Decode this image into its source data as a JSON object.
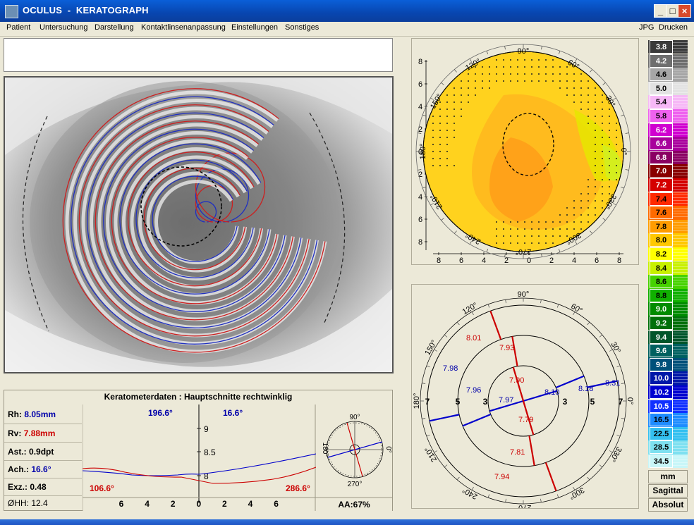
{
  "window": {
    "title": "OCULUS  -  KERATOGRAPH",
    "minimize_label": "_",
    "maximize_label": "□",
    "close_label": "×"
  },
  "menu": {
    "items": [
      "Patient",
      "Untersuchung",
      "Darstellung",
      "Kontaktlinsenanpassung",
      "Einstellungen",
      "Sonstiges"
    ],
    "right_items": [
      "JPG",
      "Drucken"
    ]
  },
  "topo_map": {
    "y_ticks": [
      "8",
      "6",
      "4",
      "2",
      "0",
      "2",
      "4",
      "6",
      "8"
    ],
    "x_ticks": [
      "8",
      "6",
      "4",
      "2",
      "0",
      "2",
      "4",
      "6",
      "8"
    ],
    "angle_labels": [
      "90°",
      "60°",
      "30°",
      "0°",
      "330°",
      "300°",
      "270°",
      "240°",
      "210°",
      "180°",
      "150°",
      "120°"
    ]
  },
  "polar_plot": {
    "angle_labels": [
      "90°",
      "60°",
      "30°",
      "0°",
      "330°",
      "300°",
      "270°",
      "240°",
      "210°",
      "180°",
      "150°",
      "120°"
    ],
    "ring_labels": [
      "7",
      "5",
      "3",
      "3",
      "5",
      "7"
    ],
    "blue_values": [
      {
        "label": "7.98",
        "r": 7.98
      },
      {
        "label": "7.96",
        "r": 7.96
      },
      {
        "label": "7.97",
        "r": 7.97
      },
      {
        "label": "8.10",
        "r": 8.1
      },
      {
        "label": "8.18",
        "r": 8.18
      },
      {
        "label": "8.31",
        "r": 8.31
      }
    ],
    "red_values": [
      {
        "label": "8.01",
        "r": 8.01
      },
      {
        "label": "7.93",
        "r": 7.93
      },
      {
        "label": "7.90",
        "r": 7.9
      },
      {
        "label": "7.79",
        "r": 7.79
      },
      {
        "label": "7.81",
        "r": 7.81
      },
      {
        "label": "7.94",
        "r": 7.94
      }
    ]
  },
  "keratometer": {
    "title": "Keratometerdaten : Hauptschnitte rechtwinklig",
    "rows": [
      {
        "label": "Rh:",
        "value": "8.05mm",
        "color": "#0000aa"
      },
      {
        "label": "Rv:",
        "value": "7.88mm",
        "color": "#cc0000"
      },
      {
        "label": "Ast.:",
        "value": "0.9dpt",
        "color": "#000000"
      },
      {
        "label": "Ach.:",
        "value": "16.6°",
        "color": "#0000aa"
      },
      {
        "label": "Exz.:",
        "value": "0.48",
        "color": "#000000"
      },
      {
        "label": "ØHH:",
        "value": "12.4",
        "color": "#000000"
      }
    ],
    "profile": {
      "angle_top_left": "196.6°",
      "angle_top_right": "16.6°",
      "angle_bottom_left": "106.6°",
      "angle_bottom_right": "286.6°",
      "y_ticks": [
        "9",
        "8.5",
        "8"
      ],
      "x_ticks": [
        "6",
        "4",
        "2",
        "0",
        "2",
        "4",
        "6"
      ]
    },
    "mini_polar": {
      "label_90": "90°",
      "label_180": "180°",
      "label_0": "0°",
      "label_270": "270°",
      "aa": "AA:67%"
    }
  },
  "scale": {
    "values": [
      {
        "v": "3.8",
        "c": "#3a3a3a",
        "t": "#ffffff"
      },
      {
        "v": "4.2",
        "c": "#6e6e6e",
        "t": "#ffffff"
      },
      {
        "v": "4.6",
        "c": "#a6a6a6",
        "t": "#000000"
      },
      {
        "v": "5.0",
        "c": "#e2e2e2",
        "t": "#000000"
      },
      {
        "v": "5.4",
        "c": "#f6b8f6",
        "t": "#000000"
      },
      {
        "v": "5.8",
        "c": "#ee62ee",
        "t": "#000000"
      },
      {
        "v": "6.2",
        "c": "#d000d0",
        "t": "#ffffff"
      },
      {
        "v": "6.6",
        "c": "#a8009c",
        "t": "#ffffff"
      },
      {
        "v": "6.8",
        "c": "#8a0062",
        "t": "#ffffff"
      },
      {
        "v": "7.0",
        "c": "#880000",
        "t": "#ffffff"
      },
      {
        "v": "7.2",
        "c": "#d40000",
        "t": "#ffffff"
      },
      {
        "v": "7.4",
        "c": "#ff2a00",
        "t": "#000000"
      },
      {
        "v": "7.6",
        "c": "#ff6a00",
        "t": "#000000"
      },
      {
        "v": "7.8",
        "c": "#ff9c00",
        "t": "#000000"
      },
      {
        "v": "8.0",
        "c": "#ffc800",
        "t": "#000000"
      },
      {
        "v": "8.2",
        "c": "#ffff00",
        "t": "#000000"
      },
      {
        "v": "8.4",
        "c": "#c8f000",
        "t": "#000000"
      },
      {
        "v": "8.6",
        "c": "#46d200",
        "t": "#000000"
      },
      {
        "v": "8.8",
        "c": "#10b000",
        "t": "#000000"
      },
      {
        "v": "9.0",
        "c": "#008c00",
        "t": "#ffffff"
      },
      {
        "v": "9.2",
        "c": "#00700a",
        "t": "#ffffff"
      },
      {
        "v": "9.4",
        "c": "#00552a",
        "t": "#ffffff"
      },
      {
        "v": "9.6",
        "c": "#006060",
        "t": "#ffffff"
      },
      {
        "v": "9.8",
        "c": "#00507a",
        "t": "#ffffff"
      },
      {
        "v": "10.0",
        "c": "#0018a8",
        "t": "#ffffff"
      },
      {
        "v": "10.2",
        "c": "#0000d0",
        "t": "#ffffff"
      },
      {
        "v": "10.5",
        "c": "#1030ff",
        "t": "#ffffff"
      },
      {
        "v": "16.5",
        "c": "#1e8cff",
        "t": "#000000"
      },
      {
        "v": "22.5",
        "c": "#34c0f0",
        "t": "#000000"
      },
      {
        "v": "28.5",
        "c": "#7ee0f0",
        "t": "#000000"
      },
      {
        "v": "34.5",
        "c": "#c8f6f8",
        "t": "#000000"
      }
    ],
    "unit": "mm",
    "mode_sagittal": "Sagittal",
    "mode_absolut": "Absolut"
  },
  "colors": {
    "blue": "#0000aa",
    "red": "#cc0000",
    "map_yellow": "#ffd21e",
    "map_orange": "#ffa61e"
  }
}
